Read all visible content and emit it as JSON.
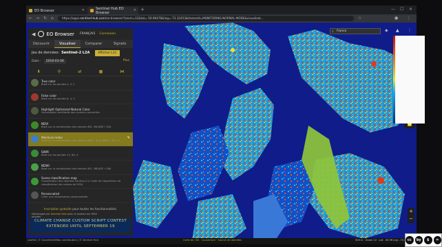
{
  "browser": {
    "tabs": [
      {
        "label": "EO Browser",
        "active": true
      },
      {
        "label": "Sentinel Hub EO Browser",
        "active": false
      }
    ],
    "url_prefix": "https://apps.",
    "url_host": "sentinel-hub.com",
    "url_path": "/eo-browser/?zoom=12&lat=-50.96478&lng=-73.32453&themeId=MONITORING-NORMAL-MODE&visualizat..."
  },
  "app": {
    "title": "EO Browser",
    "language": "FRANÇAIS",
    "login": "Connexion",
    "tabs": [
      "Découvrir",
      "Visualiser",
      "Comparer",
      "Signets"
    ],
    "active_tab": "Visualiser",
    "dataset_label": "Jeu de données:",
    "dataset_value": "Sentinel-2 L2A",
    "l1c_button": "Afficher L1C",
    "date_label": "Date :",
    "date_value": "2018-03-06",
    "plus_label": "Plus",
    "layers": [
      {
        "title": "True color",
        "desc": "Basé sur les bandes 4, 3, 2",
        "color": "#5a6b4a"
      },
      {
        "title": "False color",
        "desc": "Basé sur les bandes 8, 4, 3",
        "color": "#9c3a30"
      },
      {
        "title": "Highlight Optimized Natural Color",
        "desc": "Visualisation améliorée des couleurs naturelles",
        "color": "#4d5a40"
      },
      {
        "title": "NDVI",
        "desc": "Basé sur la combinaison des bandes (B8 - B4)/(B8 + B4)",
        "color": "#3d8a2a"
      },
      {
        "title": "Moisture Index",
        "desc": "Basé sur la combinaison des bandes (B8A - B11)/(B8A + B11) s",
        "color": "#3a7fc9"
      },
      {
        "title": "SWIR",
        "desc": "Basé sur les bandes 12, 8A, 4",
        "color": "#3a8a3a"
      },
      {
        "title": "NDWI",
        "desc": "Basé sur la combinaison des bandes (B3 - B8)/(B3 + B8)",
        "color": "#4aa04a"
      },
      {
        "title": "Scene classification map",
        "desc": "Classification des données Sentinel-2 à l'aide de l'algorithme de classification des scènes de l'ESA",
        "color": "#3a9a3a"
      },
      {
        "title": "Personnalisé",
        "desc": "Créer une visualisation personnalisée",
        "color": "#555555"
      }
    ],
    "selected_layer_index": 4,
    "footer_note_link": "Inscription gratuite",
    "footer_note_rest": " pour toutes les fonctionnalités.",
    "footer_dev_pre": "Développé par ",
    "footer_dev_link": "Sentinel Hub",
    "footer_dev_rest": " avec le soutien de l'ESA",
    "footer_dev_line2": "studios",
    "banner_line1": "CLIMATE CHANGE CUSTOM SCRIPT CONTEST",
    "banner_line2": "EXTENDED UNTIL SEPTEMBER 19"
  },
  "map": {
    "search_value": "franco",
    "bottom_left": "Leaflet | © OpenStreetMap contributors | © Sentinel Hub",
    "bottom_mid": "Carte de l'UE · Couverture · Source de données",
    "bottom_right": "500 m · Zoom 12 · Lat: -50.96 Lng: -73.32",
    "sidebar_3d": "3D"
  },
  "colors": {
    "accent": "#c9b037",
    "panel_bg": "#262626",
    "water": "#0f1c8a",
    "sidebar_icon": "#ffe14a"
  },
  "overlay": {
    "cc_labels": [
      "cc",
      "by",
      "$",
      "="
    ]
  }
}
